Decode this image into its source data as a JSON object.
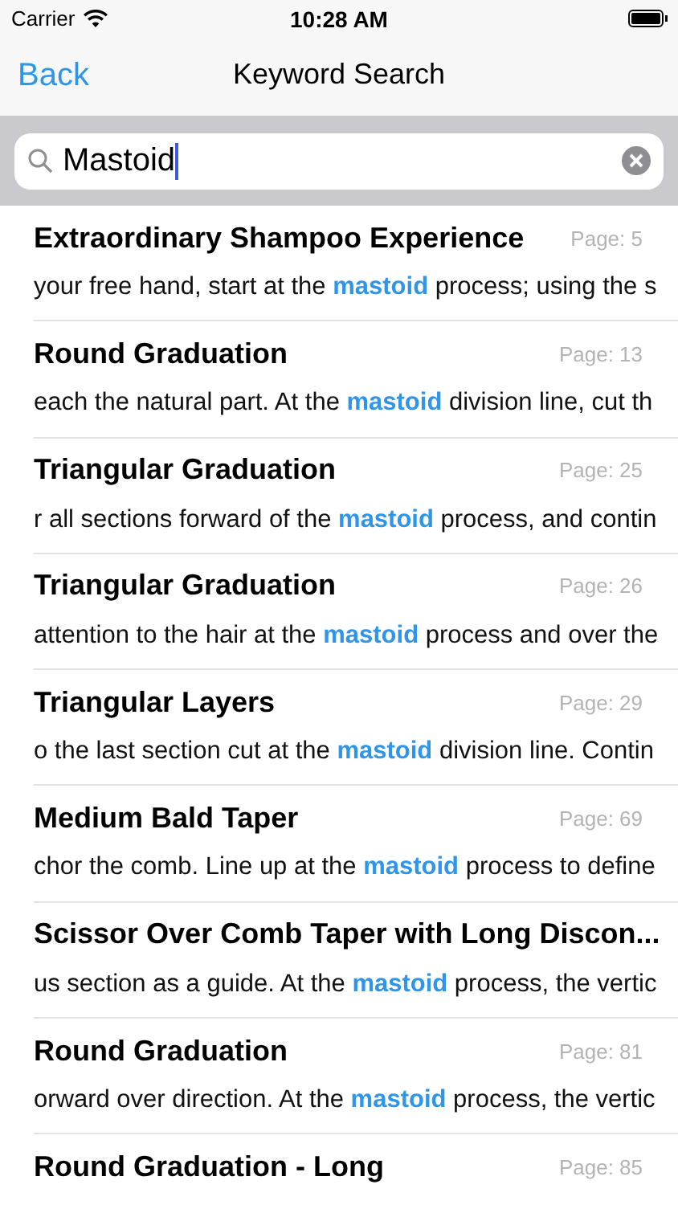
{
  "status_bar": {
    "carrier": "Carrier",
    "time": "10:28 AM"
  },
  "nav": {
    "back": "Back",
    "title": "Keyword Search"
  },
  "search": {
    "value": "Mastoid"
  },
  "results": [
    {
      "title": "Extraordinary Shampoo Experience",
      "page": "Page: 5",
      "snippet": "your free hand, start at the **mastoid** process; using the s"
    },
    {
      "title": "Round Graduation",
      "page": "Page: 13",
      "snippet": "each the natural part. At the **mastoid** division line, cut th"
    },
    {
      "title": "Triangular Graduation",
      "page": "Page: 25",
      "snippet": "r all sections forward of the **mastoid** process, and contin"
    },
    {
      "title": "Triangular Graduation",
      "page": "Page: 26",
      "snippet": "attention to the hair at the **mastoid** process and over the"
    },
    {
      "title": "Triangular Layers",
      "page": "Page: 29",
      "snippet": "o the last section cut at the **mastoid** division line. Contin"
    },
    {
      "title": "Medium Bald Taper",
      "page": "Page: 69",
      "snippet": "chor the comb. Line up at the **mastoid** process to define"
    },
    {
      "title": "Scissor Over Comb Taper with Long Discon...",
      "snippet": "us section as a guide. At the **mastoid** process, the vertic"
    },
    {
      "title": "Round Graduation",
      "page": "Page: 81",
      "snippet": "orward over direction. At the **mastoid** process, the vertic"
    },
    {
      "title": "Round Graduation - Long",
      "page": "Page: 85"
    }
  ]
}
